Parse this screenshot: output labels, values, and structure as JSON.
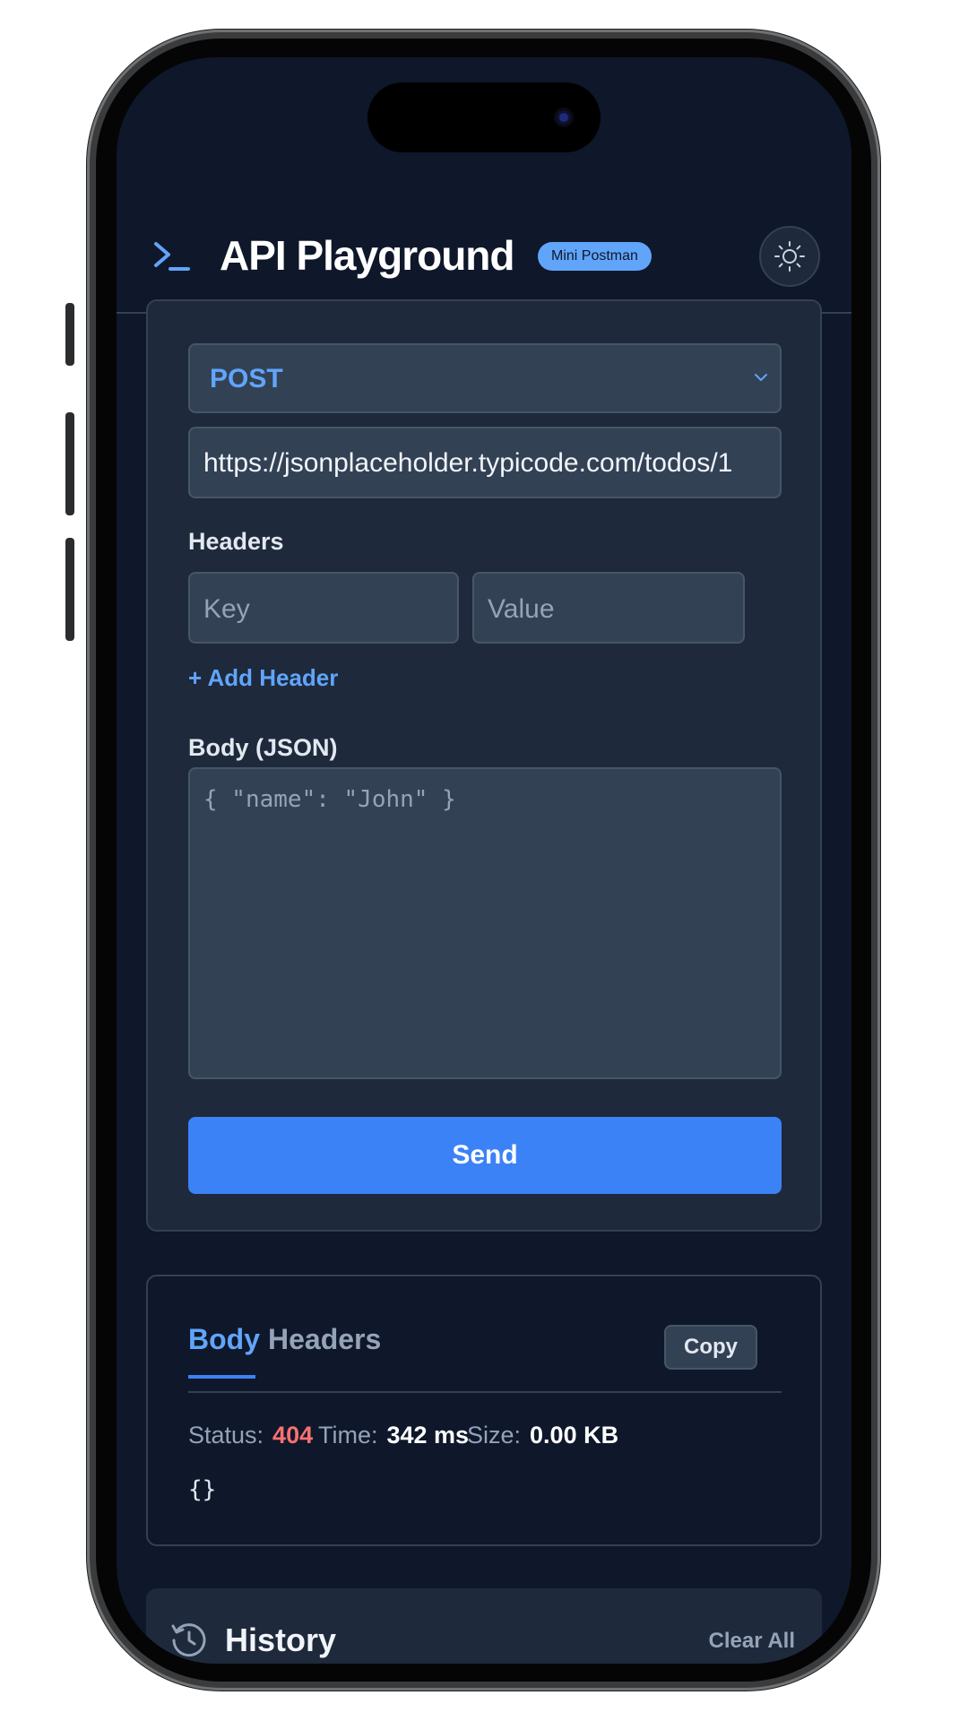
{
  "header": {
    "title": "API Playground",
    "badge": "Mini Postman"
  },
  "request": {
    "method": "POST",
    "url": "https://jsonplaceholder.typicode.com/todos/1",
    "headers_label": "Headers",
    "header_key_placeholder": "Key",
    "header_value_placeholder": "Value",
    "add_header_label": "+ Add Header",
    "body_label": "Body (JSON)",
    "body_placeholder": "{ \"name\": \"John\" }",
    "send_label": "Send"
  },
  "response": {
    "tabs": [
      {
        "label": "Body",
        "active": true
      },
      {
        "label": "Headers",
        "active": false
      }
    ],
    "copy_label": "Copy",
    "status_label": "Status:",
    "status_value": "404",
    "time_label": "Time:",
    "time_value": "342 ms",
    "size_label": "Size:",
    "size_value": "0.00 KB",
    "body": "{}"
  },
  "history": {
    "title": "History",
    "clear_label": "Clear All"
  },
  "colors": {
    "background": "#0f172a",
    "card": "#1e293b",
    "accent": "#3b82f6",
    "accent_light": "#60a5fa",
    "error": "#f87171"
  },
  "icons": {
    "logo": "terminal-prompt-icon",
    "theme": "sun-icon",
    "method_dropdown": "chevron-down-icon",
    "history": "history-clock-icon"
  }
}
